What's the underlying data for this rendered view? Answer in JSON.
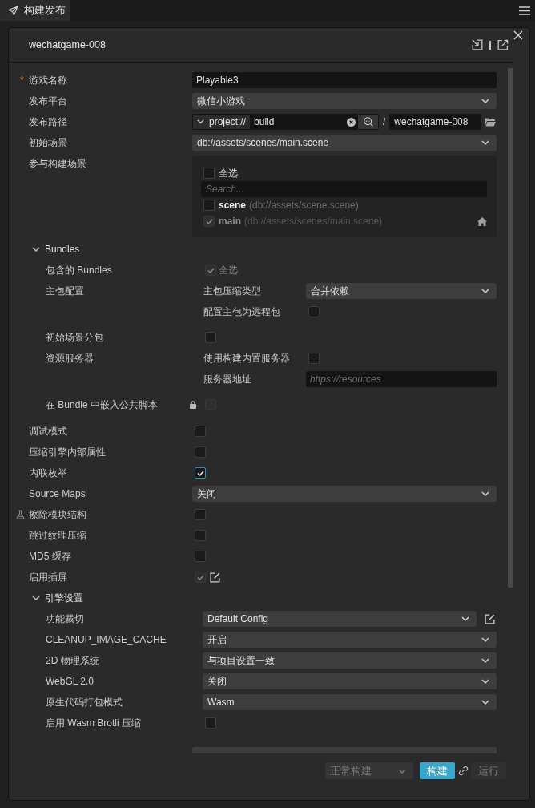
{
  "tab": {
    "label": "构建发布"
  },
  "header": {
    "title": "wechatgame-008"
  },
  "rows": [
    {
      "kind": "text",
      "label": "游戏名称",
      "marker": "*",
      "value": "Playable3"
    },
    {
      "kind": "select",
      "label": "发布平台",
      "value": "微信小游戏"
    },
    {
      "kind": "path",
      "label": "发布路径",
      "protocol": "project://",
      "value": "build",
      "separator": "/",
      "folder": "wechatgame-008"
    },
    {
      "kind": "select",
      "label": "初始场景",
      "value": "db://assets/scenes/main.scene"
    },
    {
      "kind": "scenes",
      "label": "参与构建场景",
      "select_all": {
        "label": "全选",
        "checked": false
      },
      "search": {
        "placeholder": "Search..."
      },
      "items": [
        {
          "name": "scene",
          "path": "(db://assets/scene.scene)",
          "checked": false,
          "disabled": false,
          "home": false
        },
        {
          "name": "main",
          "path": "(db://assets/scenes/main.scene)",
          "checked": true,
          "disabled": true,
          "home": true
        }
      ]
    },
    {
      "kind": "group",
      "label": "Bundles",
      "expanded": true,
      "children": [
        {
          "kind": "checkbox",
          "label": "包含的 Bundles",
          "checked": true,
          "disabled": true,
          "text": "全选"
        },
        {
          "kind": "sub",
          "label": "主包配置",
          "children": [
            {
              "kind": "select",
              "label": "主包压缩类型",
              "value": "合并依赖"
            },
            {
              "kind": "checkbox",
              "label": "配置主包为远程包",
              "checked": false
            }
          ]
        },
        {
          "kind": "checkbox",
          "label": "初始场景分包",
          "checked": false
        },
        {
          "kind": "sub",
          "label": "资源服务器",
          "children": [
            {
              "kind": "checkbox",
              "label": "使用构建内置服务器",
              "checked": false
            },
            {
              "kind": "text",
              "label": "服务器地址",
              "placeholder": "https://resources"
            }
          ]
        },
        {
          "kind": "checkbox",
          "label": "在 Bundle 中嵌入公共脚本",
          "checked": false,
          "disabled": true,
          "locked": true
        }
      ]
    },
    {
      "kind": "checkbox",
      "label": "调试模式",
      "checked": false
    },
    {
      "kind": "checkbox",
      "label": "压缩引擎内部属性",
      "checked": false
    },
    {
      "kind": "checkbox",
      "label": "内联枚举",
      "checked": true,
      "focused": true
    },
    {
      "kind": "select",
      "label": "Source Maps",
      "value": "关闭"
    },
    {
      "kind": "checkbox",
      "label": "擦除模块结构",
      "checked": false,
      "experimental": true
    },
    {
      "kind": "checkbox",
      "label": "跳过纹理压缩",
      "checked": false
    },
    {
      "kind": "checkbox",
      "label": "MD5 缓存",
      "checked": false
    },
    {
      "kind": "checkbox",
      "label": "启用插屏",
      "checked": true,
      "disabled": true,
      "editable": true
    },
    {
      "kind": "group",
      "label": "引擎设置",
      "expanded": true,
      "children": [
        {
          "kind": "select",
          "label": "功能裁切",
          "value": "Default Config",
          "editable": true
        },
        {
          "kind": "select",
          "label": "CLEANUP_IMAGE_CACHE",
          "value": "开启"
        },
        {
          "kind": "select",
          "label": "2D 物理系统",
          "value": "与项目设置一致"
        },
        {
          "kind": "select",
          "label": "WebGL 2.0",
          "value": "关闭"
        },
        {
          "kind": "select",
          "label": "原生代码打包模式",
          "value": "Wasm"
        },
        {
          "kind": "checkbox",
          "label": "启用 Wasm Brotli 压缩",
          "checked": false
        }
      ]
    }
  ],
  "footer": {
    "mode": {
      "value": "正常构建",
      "disabled": true
    },
    "build": {
      "label": "构建",
      "disabled": false
    },
    "run": {
      "label": "运行",
      "disabled": true
    }
  }
}
